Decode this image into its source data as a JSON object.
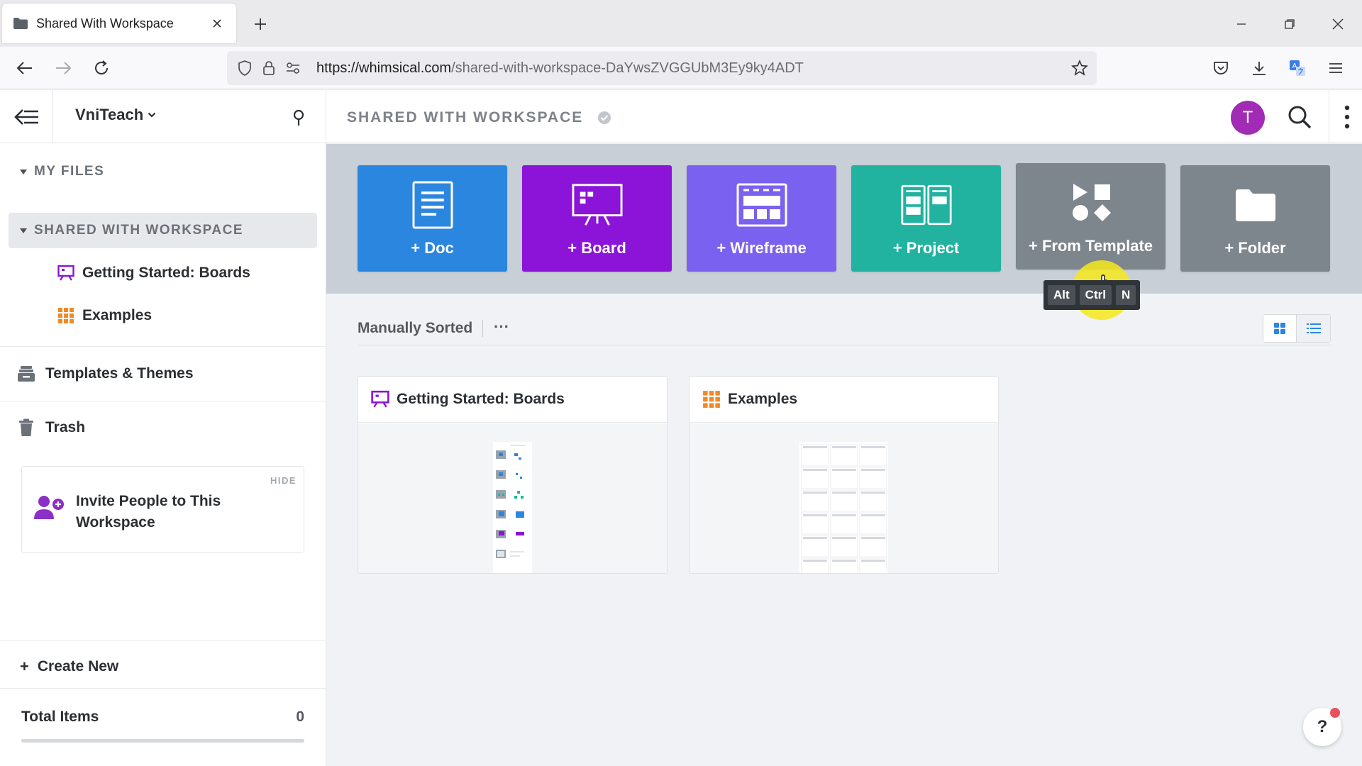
{
  "browser": {
    "tab_title": "Shared With Workspace",
    "url_domain": "https://whimsical.com",
    "url_path": "/shared-with-workspace-DaYwsZVGGUbM3Ey9ky4ADT"
  },
  "sidebar": {
    "workspace_name": "VniTeach",
    "my_files_label": "MY FILES",
    "shared_label": "SHARED WITH WORKSPACE",
    "shared_items": [
      {
        "label": "Getting Started: Boards",
        "icon": "board-icon"
      },
      {
        "label": "Examples",
        "icon": "grid-icon"
      }
    ],
    "templates_label": "Templates & Themes",
    "trash_label": "Trash",
    "invite": {
      "hide_label": "HIDE",
      "text": "Invite People to This Workspace"
    },
    "create_new_label": "Create New",
    "total_items_label": "Total Items",
    "total_items_value": "0",
    "total_items_progress": 0
  },
  "header": {
    "title": "SHARED WITH WORKSPACE",
    "avatar_initial": "T"
  },
  "create_tiles": [
    {
      "label": "+ Doc",
      "color": "#2b86df",
      "icon": "doc-icon"
    },
    {
      "label": "+ Board",
      "color": "#8b14d8",
      "icon": "board-icon"
    },
    {
      "label": "+ Wireframe",
      "color": "#7b61f0",
      "icon": "wireframe-icon"
    },
    {
      "label": "+ Project",
      "color": "#21b3a0",
      "icon": "project-icon"
    },
    {
      "label": "+ From Template",
      "color": "#7d858d",
      "icon": "template-icon"
    },
    {
      "label": "+ Folder",
      "color": "#7d858d",
      "icon": "folder-icon"
    }
  ],
  "shortcut_keys": [
    "Alt",
    "Ctrl",
    "N"
  ],
  "sort": {
    "label": "Manually Sorted",
    "more": "···"
  },
  "cards": [
    {
      "title": "Getting Started: Boards",
      "icon": "board-icon",
      "icon_color": "#8b14d8"
    },
    {
      "title": "Examples",
      "icon": "grid-icon",
      "icon_color": "#f08a24"
    }
  ],
  "help_label": "?"
}
